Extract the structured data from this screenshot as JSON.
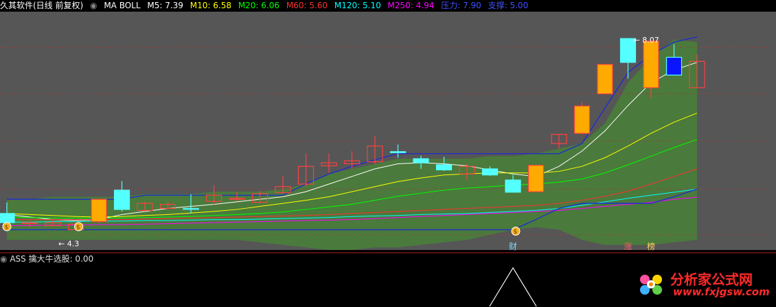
{
  "header": {
    "title": "久其软件(日线 前复权)",
    "indicator": "MA  BOLL",
    "items": [
      {
        "label": "M5: 7.39",
        "color": "#ffffff"
      },
      {
        "label": "M10: 6.58",
        "color": "#ffff00"
      },
      {
        "label": "M20: 6.06",
        "color": "#00ff00"
      },
      {
        "label": "M60: 5.60",
        "color": "#ff3030"
      },
      {
        "label": "M120: 5.10",
        "color": "#00ffff"
      },
      {
        "label": "M250: 4.94",
        "color": "#ff00ff"
      },
      {
        "label": "压力: 7.90",
        "color": "#4050ff"
      },
      {
        "label": "支撑: 5.00",
        "color": "#4050ff"
      }
    ]
  },
  "subpanel": {
    "label": "ASS 擒大牛选股: 0.00"
  },
  "watermark": {
    "cn": "分析家公式网",
    "url": "www.fxjgsw.com"
  },
  "chart_data": {
    "type": "candlestick",
    "colors": {
      "up": "#ff4040",
      "down": "#54ffff",
      "bull_fill": "#ffaa00",
      "band": "#4a7a3c",
      "blue": "#ffffff"
    },
    "price_range": [
      3.9,
      8.6
    ],
    "grid_prices": [
      7.9,
      6.98,
      6.05,
      5.1,
      4.2
    ],
    "high_annotation": {
      "text": "8.07",
      "value": 8.07
    },
    "low_annotation": {
      "text": "4.3",
      "value": 4.3
    },
    "candles": [
      {
        "o": 4.62,
        "c": 4.44,
        "h": 4.84,
        "l": 4.42,
        "style": "down"
      },
      {
        "o": 4.44,
        "c": 4.42,
        "h": 4.48,
        "l": 4.36,
        "style": "up"
      },
      {
        "o": 4.38,
        "c": 4.44,
        "h": 4.5,
        "l": 4.38,
        "style": "up"
      },
      {
        "o": 4.3,
        "c": 4.41,
        "h": 4.47,
        "l": 4.3,
        "style": "up"
      },
      {
        "o": 4.46,
        "c": 4.9,
        "h": 4.9,
        "l": 4.43,
        "style": "bull"
      },
      {
        "o": 5.08,
        "c": 4.7,
        "h": 5.26,
        "l": 4.66,
        "style": "down"
      },
      {
        "o": 4.68,
        "c": 4.82,
        "h": 4.85,
        "l": 4.66,
        "style": "up"
      },
      {
        "o": 4.72,
        "c": 4.8,
        "h": 4.86,
        "l": 4.7,
        "style": "up"
      },
      {
        "o": 4.7,
        "c": 4.72,
        "h": 5.0,
        "l": 4.62,
        "style": "doji"
      },
      {
        "o": 4.86,
        "c": 4.98,
        "h": 5.18,
        "l": 4.78,
        "style": "up"
      },
      {
        "o": 4.92,
        "c": 4.9,
        "h": 5.04,
        "l": 4.86,
        "style": "up"
      },
      {
        "o": 4.84,
        "c": 5.01,
        "h": 5.07,
        "l": 4.84,
        "style": "up"
      },
      {
        "o": 5.03,
        "c": 5.15,
        "h": 5.35,
        "l": 5.03,
        "style": "up"
      },
      {
        "o": 5.2,
        "c": 5.55,
        "h": 5.8,
        "l": 5.14,
        "style": "up"
      },
      {
        "o": 5.56,
        "c": 5.62,
        "h": 5.8,
        "l": 5.42,
        "style": "up"
      },
      {
        "o": 5.6,
        "c": 5.66,
        "h": 5.85,
        "l": 5.5,
        "style": "up"
      },
      {
        "o": 5.64,
        "c": 5.95,
        "h": 6.15,
        "l": 5.6,
        "style": "up"
      },
      {
        "o": 5.82,
        "c": 5.84,
        "h": 5.98,
        "l": 5.72,
        "style": "down"
      },
      {
        "o": 5.7,
        "c": 5.62,
        "h": 5.76,
        "l": 5.5,
        "style": "down"
      },
      {
        "o": 5.58,
        "c": 5.48,
        "h": 5.74,
        "l": 5.46,
        "style": "down"
      },
      {
        "o": 5.4,
        "c": 5.55,
        "h": 5.6,
        "l": 5.28,
        "style": "up"
      },
      {
        "o": 5.5,
        "c": 5.38,
        "h": 5.55,
        "l": 5.36,
        "style": "down"
      },
      {
        "o": 5.28,
        "c": 5.04,
        "h": 5.38,
        "l": 5.04,
        "style": "down"
      },
      {
        "o": 5.05,
        "c": 5.57,
        "h": 5.57,
        "l": 5.05,
        "style": "bull"
      },
      {
        "o": 6.0,
        "c": 6.18,
        "h": 6.18,
        "l": 5.9,
        "style": "up"
      },
      {
        "o": 6.2,
        "c": 6.74,
        "h": 6.82,
        "l": 6.18,
        "style": "bull"
      },
      {
        "o": 6.98,
        "c": 7.56,
        "h": 7.56,
        "l": 6.98,
        "style": "bull"
      },
      {
        "o": 7.6,
        "c": 8.07,
        "h": 8.07,
        "l": 7.28,
        "style": "down"
      },
      {
        "o": 7.1,
        "c": 8.02,
        "h": 8.02,
        "l": 6.9,
        "style": "bull"
      },
      {
        "o": 7.7,
        "c": 7.35,
        "h": 7.96,
        "l": 7.35,
        "style": "blue"
      },
      {
        "o": 7.62,
        "c": 7.1,
        "h": 7.76,
        "l": 7.1,
        "style": "up"
      }
    ],
    "band_upper": [
      4.9,
      4.9,
      4.95,
      4.95,
      4.95,
      4.95,
      5.0,
      5.0,
      5.0,
      5.05,
      5.05,
      5.05,
      5.1,
      5.2,
      5.4,
      5.5,
      5.6,
      5.7,
      5.7,
      5.7,
      5.7,
      5.75,
      5.75,
      5.8,
      5.9,
      6.0,
      6.4,
      7.2,
      7.7,
      8.05,
      8.0
    ],
    "band_lower": [
      4.1,
      4.1,
      4.1,
      4.1,
      4.1,
      4.1,
      4.1,
      4.1,
      4.1,
      4.1,
      4.1,
      4.05,
      4.0,
      3.95,
      3.9,
      3.9,
      3.95,
      3.95,
      4.0,
      4.05,
      4.1,
      4.2,
      4.3,
      4.35,
      4.3,
      4.1,
      4.0,
      4.0,
      4.0,
      4.05,
      4.1
    ],
    "ma": [
      {
        "name": "M5",
        "color": "#ffffff",
        "values": [
          4.6,
          4.55,
          4.5,
          4.48,
          4.5,
          4.6,
          4.66,
          4.72,
          4.76,
          4.8,
          4.85,
          4.9,
          4.95,
          5.05,
          5.2,
          5.35,
          5.5,
          5.6,
          5.62,
          5.6,
          5.56,
          5.48,
          5.4,
          5.35,
          5.55,
          5.85,
          6.25,
          6.75,
          7.2,
          7.45,
          7.6
        ]
      },
      {
        "name": "M10",
        "color": "#ffff00",
        "values": [
          4.62,
          4.6,
          4.58,
          4.56,
          4.55,
          4.56,
          4.58,
          4.6,
          4.63,
          4.66,
          4.7,
          4.76,
          4.82,
          4.88,
          4.95,
          5.05,
          5.15,
          5.25,
          5.32,
          5.38,
          5.4,
          5.42,
          5.42,
          5.42,
          5.45,
          5.55,
          5.72,
          5.95,
          6.2,
          6.42,
          6.6
        ]
      },
      {
        "name": "M20",
        "color": "#00ff00",
        "values": [
          4.55,
          4.54,
          4.53,
          4.53,
          4.53,
          4.53,
          4.54,
          4.55,
          4.56,
          4.58,
          4.6,
          4.62,
          4.65,
          4.7,
          4.75,
          4.8,
          4.88,
          4.96,
          5.02,
          5.08,
          5.12,
          5.15,
          5.18,
          5.2,
          5.24,
          5.3,
          5.42,
          5.58,
          5.75,
          5.92,
          6.08
        ]
      },
      {
        "name": "M60",
        "color": "#ff3030",
        "values": [
          4.5,
          4.5,
          4.5,
          4.5,
          4.5,
          4.5,
          4.51,
          4.52,
          4.53,
          4.54,
          4.55,
          4.56,
          4.57,
          4.58,
          4.6,
          4.62,
          4.64,
          4.66,
          4.68,
          4.7,
          4.72,
          4.74,
          4.76,
          4.78,
          4.82,
          4.88,
          4.96,
          5.06,
          5.2,
          5.35,
          5.5
        ]
      },
      {
        "name": "M120",
        "color": "#00ffff",
        "values": [
          4.45,
          4.45,
          4.46,
          4.46,
          4.47,
          4.47,
          4.48,
          4.48,
          4.49,
          4.5,
          4.5,
          4.51,
          4.52,
          4.53,
          4.54,
          4.56,
          4.57,
          4.58,
          4.6,
          4.61,
          4.62,
          4.64,
          4.66,
          4.68,
          4.72,
          4.78,
          4.85,
          4.92,
          4.98,
          5.04,
          5.1
        ]
      },
      {
        "name": "M250",
        "color": "#ff00ff",
        "values": [
          4.38,
          4.38,
          4.39,
          4.39,
          4.4,
          4.4,
          4.41,
          4.42,
          4.43,
          4.44,
          4.45,
          4.46,
          4.47,
          4.48,
          4.49,
          4.5,
          4.52,
          4.54,
          4.56,
          4.58,
          4.6,
          4.62,
          4.64,
          4.66,
          4.68,
          4.72,
          4.76,
          4.8,
          4.84,
          4.9,
          4.94
        ]
      }
    ],
    "resistance": [
      4.9,
      4.9,
      4.9,
      4.9,
      4.9,
      4.9,
      4.98,
      4.98,
      4.98,
      4.98,
      4.98,
      4.98,
      4.98,
      5.2,
      5.4,
      5.55,
      5.68,
      5.8,
      5.8,
      5.8,
      5.8,
      5.8,
      5.8,
      5.8,
      5.8,
      6.0,
      6.7,
      7.4,
      7.75,
      8.0,
      8.1
    ],
    "support": [
      4.3,
      4.3,
      4.3,
      4.3,
      4.3,
      4.3,
      4.3,
      4.3,
      4.3,
      4.3,
      4.3,
      4.3,
      4.3,
      4.3,
      4.3,
      4.3,
      4.3,
      4.3,
      4.3,
      4.3,
      4.3,
      4.3,
      4.3,
      4.5,
      4.72,
      4.82,
      4.82,
      4.82,
      4.82,
      4.95,
      5.1
    ],
    "markers": [
      {
        "index": 0,
        "kind": "coin"
      },
      {
        "index": 3,
        "kind": "coin"
      },
      {
        "index": 22,
        "kind": "coin"
      }
    ],
    "bottom_tags": [
      {
        "index": 22,
        "text": "财",
        "color": "#7fd8ff"
      },
      {
        "index": 27,
        "text": "涨",
        "color": "#ff6060"
      },
      {
        "index": 28,
        "text": "榜",
        "color": "#ffd060"
      }
    ],
    "indicator_series": {
      "name": "擒大牛选股",
      "peak_index": 22,
      "values": [
        0,
        1,
        0
      ]
    }
  }
}
